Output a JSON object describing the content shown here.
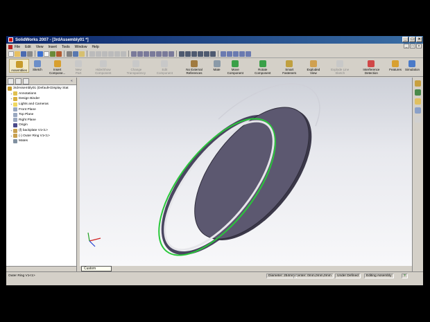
{
  "window": {
    "title": "SolidWorks 2007 - [3rdAssembly01 *]"
  },
  "menu": [
    "File",
    "Edit",
    "View",
    "Insert",
    "Tools",
    "Window",
    "Help"
  ],
  "window_controls": {
    "minimize": "_",
    "maximize": "□",
    "close": "×"
  },
  "command_manager": [
    {
      "label": "Assemblies",
      "enabled": true,
      "active": true
    },
    {
      "label": "Sketch",
      "enabled": true
    },
    {
      "label": "Insert Compone...",
      "enabled": true
    },
    {
      "label": "New Part",
      "enabled": false
    },
    {
      "label": "Hide/Show Component",
      "enabled": false
    },
    {
      "label": "Change Transparency",
      "enabled": false
    },
    {
      "label": "Edit Component",
      "enabled": false
    },
    {
      "label": "No External References",
      "enabled": true
    },
    {
      "label": "Mate",
      "enabled": true
    },
    {
      "label": "Move Component",
      "enabled": true
    },
    {
      "label": "Rotate Component",
      "enabled": true
    },
    {
      "label": "Smart Fasteners",
      "enabled": true
    },
    {
      "label": "Exploded View",
      "enabled": true
    },
    {
      "label": "Explode Line Sketch",
      "enabled": false
    },
    {
      "label": "Interference Detection",
      "enabled": true
    },
    {
      "label": "Features",
      "enabled": true
    },
    {
      "label": "Simulation",
      "enabled": true
    }
  ],
  "feature_tree": {
    "root": "3rdAssembly01 (Default<Display Stat",
    "items": [
      {
        "label": "Annotations",
        "expander": "+"
      },
      {
        "label": "Design Binder",
        "expander": "+"
      },
      {
        "label": "Lights and Cameras",
        "expander": "+"
      },
      {
        "label": "Front Plane",
        "expander": ""
      },
      {
        "label": "Top Plane",
        "expander": ""
      },
      {
        "label": "Right Plane",
        "expander": ""
      },
      {
        "label": "Origin",
        "expander": ""
      },
      {
        "label": "(f) backplate V1<1>",
        "expander": "+"
      },
      {
        "label": "(-) Outer Ring V1<1>",
        "expander": "+"
      },
      {
        "label": "Mates",
        "expander": ""
      }
    ]
  },
  "view": {
    "orientation": "Custom"
  },
  "status": {
    "selection": "Outer Ring V1<1>",
    "diameter": "Diameter: 254mm",
    "center": "Center: 0mm,0mm,0mm",
    "defined": "Under Defined",
    "mode": "Editing Assembly",
    "help": "?"
  },
  "colors": {
    "selection_highlight": "#29c83a",
    "part_face": "#5c5870",
    "viewport_top": "#cdd0d8",
    "title_bar": "#0a246a"
  }
}
